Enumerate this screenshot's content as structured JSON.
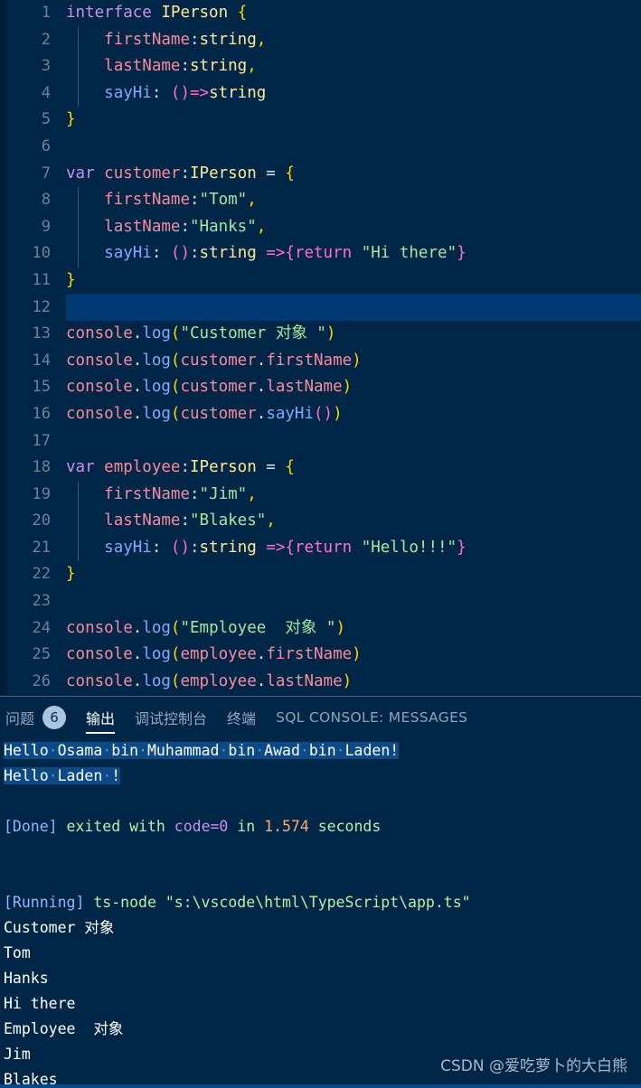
{
  "editor": {
    "language": "typescript",
    "active_line": 12,
    "total_lines": 26,
    "line_numbers": [
      "1",
      "2",
      "3",
      "4",
      "5",
      "6",
      "7",
      "8",
      "9",
      "10",
      "11",
      "12",
      "13",
      "14",
      "15",
      "16",
      "17",
      "18",
      "19",
      "20",
      "21",
      "22",
      "23",
      "24",
      "25",
      "26"
    ],
    "lines": [
      {
        "n": "1",
        "text": "interface IPerson {"
      },
      {
        "n": "2",
        "text": "    firstName:string,"
      },
      {
        "n": "3",
        "text": "    lastName:string,"
      },
      {
        "n": "4",
        "text": "    sayHi: ()=>string"
      },
      {
        "n": "5",
        "text": "}"
      },
      {
        "n": "6",
        "text": ""
      },
      {
        "n": "7",
        "text": "var customer:IPerson = {"
      },
      {
        "n": "8",
        "text": "    firstName:\"Tom\","
      },
      {
        "n": "9",
        "text": "    lastName:\"Hanks\","
      },
      {
        "n": "10",
        "text": "    sayHi: ():string =>{return \"Hi there\"}"
      },
      {
        "n": "11",
        "text": "}"
      },
      {
        "n": "12",
        "text": ""
      },
      {
        "n": "13",
        "text": "console.log(\"Customer 对象 \")"
      },
      {
        "n": "14",
        "text": "console.log(customer.firstName)"
      },
      {
        "n": "15",
        "text": "console.log(customer.lastName)"
      },
      {
        "n": "16",
        "text": "console.log(customer.sayHi())"
      },
      {
        "n": "17",
        "text": ""
      },
      {
        "n": "18",
        "text": "var employee:IPerson = {"
      },
      {
        "n": "19",
        "text": "    firstName:\"Jim\","
      },
      {
        "n": "20",
        "text": "    lastName:\"Blakes\","
      },
      {
        "n": "21",
        "text": "    sayHi: ():string =>{return \"Hello!!!\"}"
      },
      {
        "n": "22",
        "text": "}"
      },
      {
        "n": "23",
        "text": ""
      },
      {
        "n": "24",
        "text": "console.log(\"Employee  对象 \")"
      },
      {
        "n": "25",
        "text": "console.log(employee.firstName)"
      },
      {
        "n": "26",
        "text": "console.log(employee.lastName)"
      }
    ]
  },
  "panel": {
    "tabs": [
      {
        "label": "问题",
        "badge": "6",
        "active": false
      },
      {
        "label": "输出",
        "badge": "",
        "active": true
      },
      {
        "label": "调试控制台",
        "badge": "",
        "active": false
      },
      {
        "label": "终端",
        "badge": "",
        "active": false
      },
      {
        "label": "SQL CONSOLE: MESSAGES",
        "badge": "",
        "active": false
      }
    ],
    "console_lines": [
      "Hello Osama bin Muhammad bin Awad bin Laden!",
      "Hello Laden !",
      "",
      "[Done] exited with code=0 in 1.574 seconds",
      "",
      "[Running] ts-node \"s:\\vscode\\html\\TypeScript\\app.ts\"",
      "Customer 对象",
      "Tom",
      "Hanks",
      "Hi there",
      "Employee  对象",
      "Jim",
      "Blakes"
    ],
    "done_text": {
      "tag": "[Done]",
      "exited_with": "exited with",
      "code": "code=0",
      "in": "in",
      "duration": "1.574",
      "seconds": "seconds"
    },
    "running_text": {
      "tag": "[Running]",
      "command": "ts-node \"s:\\vscode\\html\\TypeScript\\app.ts\""
    },
    "selection_lines": [
      "Hello·Osama·bin·Muhammad·bin·Awad·bin·Laden!",
      "Hello·Laden·!"
    ]
  },
  "watermark": {
    "text": "CSDN @爱吃萝卜的大白熊"
  },
  "colors": {
    "editor_bg": "#002647",
    "active_line_bg": "#003a73",
    "gutter_fg": "#6c839c",
    "keyword": "#c792ea",
    "type": "#ffeb95",
    "brace_yellow": "#ffd700",
    "property": "#f78c9c",
    "function": "#82aaff",
    "string": "#a5e8a0",
    "pink": "#ff6fcf",
    "selection": "#0b4a86",
    "badge_bg": "#a8c5e2"
  }
}
